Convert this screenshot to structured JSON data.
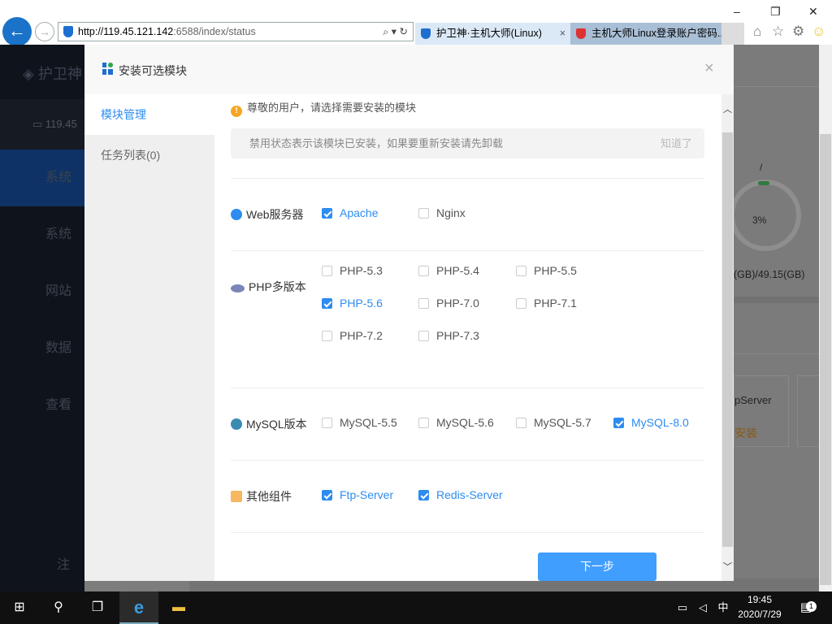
{
  "browser": {
    "url_host": "http://119.45.121.142",
    "url_rest": ":6588/index/status",
    "tabs": [
      {
        "label": "护卫神·主机大师(Linux)",
        "color": "#1e6fd0"
      },
      {
        "label": "主机大师Linux登录账户密码...",
        "color": "#d33"
      }
    ]
  },
  "background": {
    "brand": "护卫神",
    "server": "119.45",
    "nav": [
      "系统",
      "系统",
      "网站",
      "数据",
      "查看"
    ],
    "logout": "注",
    "disk_label": "/",
    "disk_percent": "3%",
    "disk_size": "(GB)/49.15(GB)",
    "card_name": "pServer",
    "card_action": "安装"
  },
  "modal": {
    "title": "安装可选模块",
    "nav": [
      {
        "label": "模块管理",
        "active": true
      },
      {
        "label": "任务列表(0)",
        "active": false
      }
    ],
    "tip": "尊敬的用户，请选择需要安装的模块",
    "notice": "禁用状态表示该模块已安装，如果要重新安装请先卸载",
    "notice_ok": "知道了",
    "sections": [
      {
        "label": "Web服务器",
        "icon": "globe-icon",
        "options": [
          {
            "label": "Apache",
            "checked": true
          },
          {
            "label": "Nginx",
            "checked": false
          }
        ]
      },
      {
        "label": "PHP多版本",
        "icon": "php-icon",
        "options": [
          {
            "label": "PHP-5.3",
            "checked": false
          },
          {
            "label": "PHP-5.4",
            "checked": false
          },
          {
            "label": "PHP-5.5",
            "checked": false
          },
          {
            "label": "PHP-5.6",
            "checked": true
          },
          {
            "label": "PHP-7.0",
            "checked": false
          },
          {
            "label": "PHP-7.1",
            "checked": false
          },
          {
            "label": "PHP-7.2",
            "checked": false
          },
          {
            "label": "PHP-7.3",
            "checked": false
          }
        ]
      },
      {
        "label": "MySQL版本",
        "icon": "mysql-icon",
        "options": [
          {
            "label": "MySQL-5.5",
            "checked": false
          },
          {
            "label": "MySQL-5.6",
            "checked": false
          },
          {
            "label": "MySQL-5.7",
            "checked": false
          },
          {
            "label": "MySQL-8.0",
            "checked": true
          }
        ]
      },
      {
        "label": "其他组件",
        "icon": "ftp-folder-icon",
        "options": [
          {
            "label": "Ftp-Server",
            "checked": true
          },
          {
            "label": "Redis-Server",
            "checked": true
          }
        ]
      }
    ],
    "next_label": "下一步"
  },
  "taskbar": {
    "time": "19:45",
    "date": "2020/7/29",
    "ime": "中",
    "notifications": "1"
  }
}
